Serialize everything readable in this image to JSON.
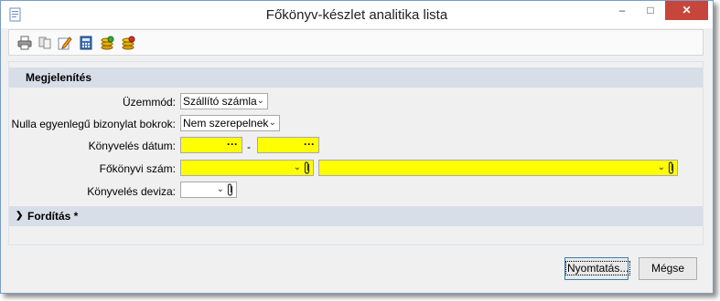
{
  "window": {
    "title": "Főkönyv-készlet analitika lista"
  },
  "window_controls": {
    "minimize": "–",
    "maximize": "□",
    "close": "✕"
  },
  "toolbar": {
    "icons": [
      "print-icon",
      "copy-icon",
      "edit-icon",
      "calculator-icon",
      "coins-green-icon",
      "coins-red-icon"
    ]
  },
  "sections": {
    "display": {
      "label": "Megjelenítés",
      "chevron": "▾"
    },
    "translation": {
      "label": "Fordítás *",
      "chevron": "❯"
    }
  },
  "form": {
    "mode": {
      "label": "Üzemmód:",
      "value": "Szállító számla"
    },
    "zero_balance": {
      "label": "Nulla egyenlegű bizonylat bokrok:",
      "value": "Nem szerepelnek"
    },
    "posting_date": {
      "label": "Könyvelés dátum:",
      "from": "",
      "to": "",
      "separator": "-",
      "picker": "···"
    },
    "gl_account": {
      "label": "Főkönyvi szám:",
      "value": "",
      "name_value": ""
    },
    "posting_currency": {
      "label": "Könyvelés deviza:",
      "value": ""
    }
  },
  "buttons": {
    "print": "Nyomtatás...",
    "cancel": "Mégse"
  },
  "colors": {
    "required_field": "#ffff00",
    "section_header": "#d8dee8",
    "close_button": "#c7463b"
  }
}
